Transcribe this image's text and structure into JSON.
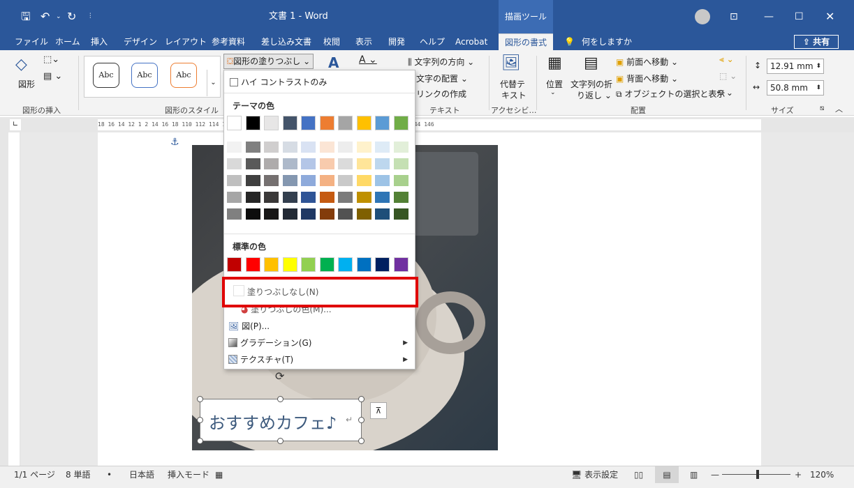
{
  "window": {
    "title": "文書 1  -  Word",
    "context_tool": "描画ツール",
    "share_label": "共有"
  },
  "quick_access": [
    "save-icon",
    "undo-icon",
    "redo-icon",
    "customize-icon"
  ],
  "tabs": [
    {
      "label": "ファイル"
    },
    {
      "label": "ホーム"
    },
    {
      "label": "挿入"
    },
    {
      "label": "デザイン"
    },
    {
      "label": "レイアウト"
    },
    {
      "label": "参考資料"
    },
    {
      "label": "差し込み文書"
    },
    {
      "label": "校閲"
    },
    {
      "label": "表示"
    },
    {
      "label": "開発"
    },
    {
      "label": "ヘルプ"
    },
    {
      "label": "Acrobat"
    },
    {
      "label": "図形の書式"
    },
    {
      "label": "何をしますか"
    }
  ],
  "ribbon": {
    "insert_shape": {
      "label": "図形",
      "group": "図形の挿入"
    },
    "shape_styles": {
      "sample": "Abc",
      "group": "図形のスタイル"
    },
    "fill_button": "図形の塗りつぶし",
    "text": {
      "direction": "文字列の方向",
      "align": "文字の配置",
      "link": "リンクの作成",
      "group": "テキスト"
    },
    "alt_text": {
      "line1": "代替テ",
      "line2": "キスト",
      "group": "アクセシビ…"
    },
    "arrange": {
      "position": "位置",
      "wrap_line1": "文字列の折",
      "wrap_line2": "り返し",
      "bring_forward": "前面へ移動",
      "send_backward": "背面へ移動",
      "selection_pane": "オブジェクトの選択と表示",
      "group": "配置"
    },
    "size": {
      "height": "12.91 mm",
      "width": "50.8 mm",
      "group": "サイズ"
    }
  },
  "fill_menu": {
    "high_contrast": "ハイ コントラストのみ",
    "theme_heading": "テーマの色",
    "theme_colors": [
      "#ffffff",
      "#000000",
      "#e7e6e6",
      "#44546a",
      "#4472c4",
      "#ed7d31",
      "#a5a5a5",
      "#ffc000",
      "#5b9bd5",
      "#70ad47"
    ],
    "theme_shades": [
      [
        "#f2f2f2",
        "#d9d9d9",
        "#bfbfbf",
        "#a6a6a6",
        "#808080"
      ],
      [
        "#808080",
        "#595959",
        "#404040",
        "#262626",
        "#0d0d0d"
      ],
      [
        "#d0cece",
        "#aeabab",
        "#757070",
        "#3a3838",
        "#171616"
      ],
      [
        "#d6dce4",
        "#adb9ca",
        "#8497b0",
        "#333f4f",
        "#222a35"
      ],
      [
        "#d9e2f3",
        "#b4c6e7",
        "#8eaadb",
        "#2f5496",
        "#1f3864"
      ],
      [
        "#fbe5d5",
        "#f8cbad",
        "#f4b183",
        "#c55a11",
        "#833c0b"
      ],
      [
        "#ededed",
        "#dbdbdb",
        "#c9c9c9",
        "#7b7b7b",
        "#525252"
      ],
      [
        "#fff2cc",
        "#ffe599",
        "#ffd966",
        "#bf9000",
        "#7f6000"
      ],
      [
        "#deebf6",
        "#bdd7ee",
        "#9dc3e6",
        "#2e75b5",
        "#1e4e79"
      ],
      [
        "#e2efd9",
        "#c5e0b3",
        "#a8d08d",
        "#538135",
        "#375623"
      ]
    ],
    "standard_heading": "標準の色",
    "standard_colors": [
      "#c00000",
      "#ff0000",
      "#ffc000",
      "#ffff00",
      "#92d050",
      "#00b050",
      "#00b0f0",
      "#0070c0",
      "#002060",
      "#7030a0"
    ],
    "no_fill": "塗りつぶしなし(N)",
    "more_colors": "塗りつぶしの色(M)...",
    "picture": "図(P)...",
    "gradient": "グラデーション(G)",
    "texture": "テクスチャ(T)"
  },
  "highlight_color": "#e00000",
  "document": {
    "textbox_text": "おすすめカフェ♪"
  },
  "ruler_h": "18  16  14  12  1      2  14  16  18  110  112  114  116  118  120  122  124  126  128  130  132  134  136  138  140  142  144  146",
  "statusbar": {
    "page": "1/1 ページ",
    "words": "8 単語",
    "language": "日本語",
    "mode": "挿入モード",
    "display_settings": "表示設定",
    "zoom": "120%"
  }
}
